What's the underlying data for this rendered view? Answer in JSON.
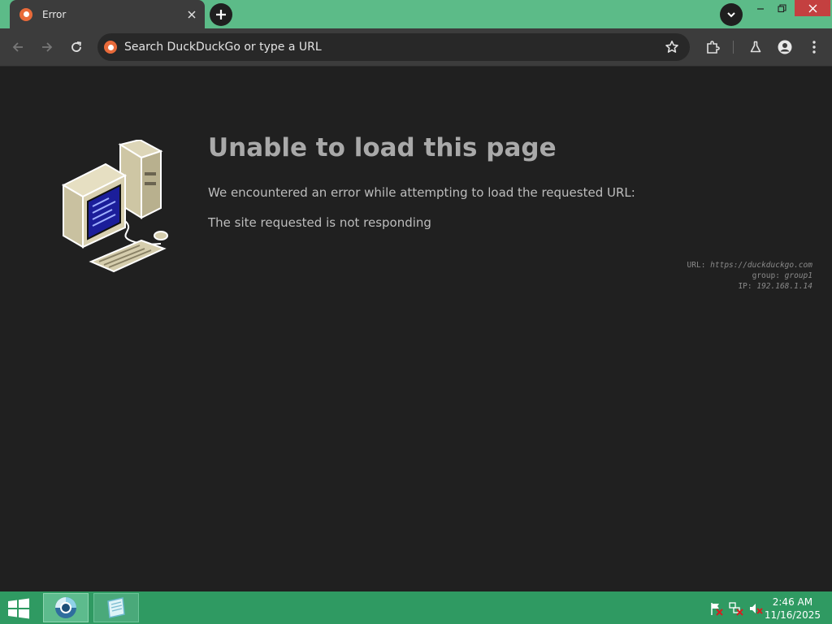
{
  "browser": {
    "tab": {
      "title": "Error"
    },
    "omnibox": {
      "placeholder": "Search DuckDuckGo or type a URL"
    }
  },
  "page": {
    "title": "Unable to load this page",
    "description": "We encountered an error while attempting to load the requested URL:",
    "reason": "The site requested is not responding",
    "meta": {
      "url_label": "URL:",
      "url_value": "https://duckduckgo.com",
      "group_label": "group:",
      "group_value": "group1",
      "ip_label": "IP:",
      "ip_value": "192.168.1.14"
    }
  },
  "taskbar": {
    "clock": {
      "time": "2:46 AM",
      "date": "11/16/2025"
    }
  },
  "colors": {
    "tabstrip": "#5cbb88",
    "toolbar": "#3c3c3c",
    "page_bg": "#202020",
    "taskbar": "#2f9a62",
    "close_button": "#c44040"
  },
  "icons": [
    "duckduckgo-icon",
    "close-icon",
    "plus-icon",
    "chevron-down-icon",
    "minimize-icon",
    "maximize-icon",
    "back-arrow-icon",
    "forward-arrow-icon",
    "reload-icon",
    "star-icon",
    "extensions-icon",
    "labs-flask-icon",
    "profile-icon",
    "more-vertical-icon",
    "windows-logo-icon",
    "flag-icon",
    "network-icon",
    "volume-muted-icon"
  ]
}
